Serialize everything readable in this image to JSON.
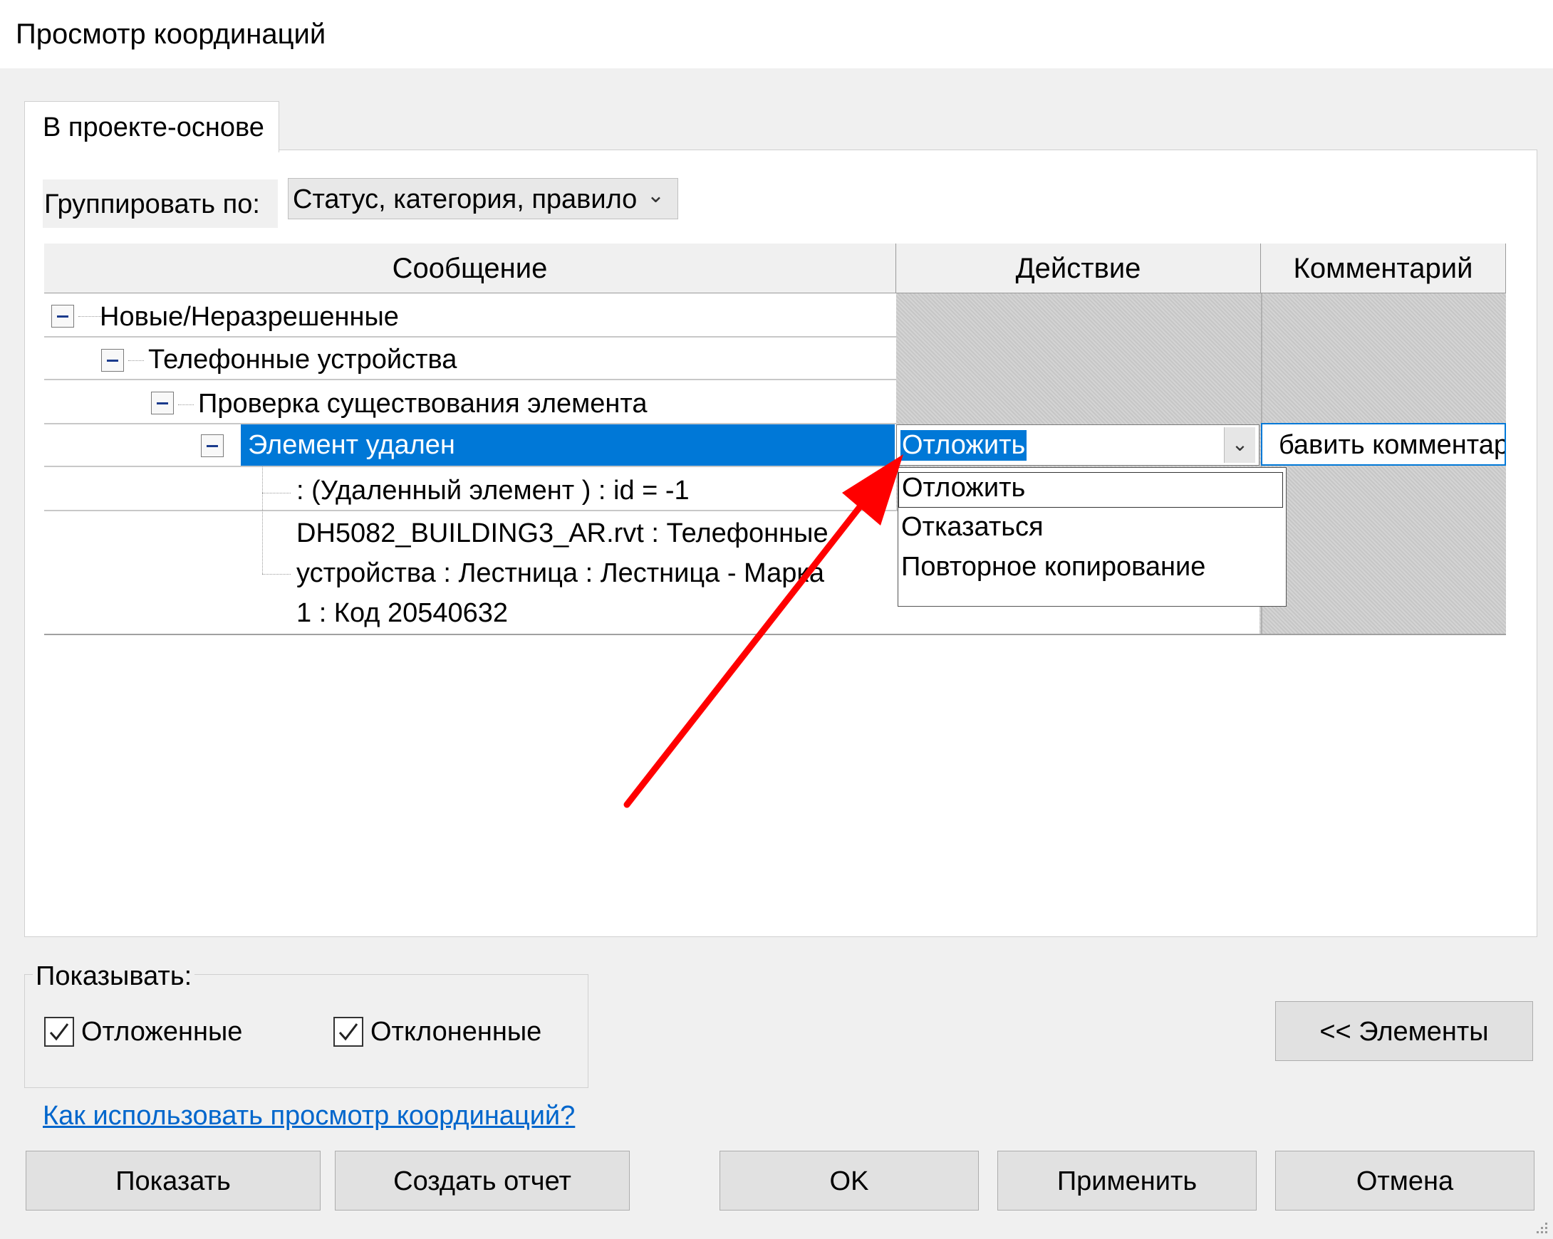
{
  "window": {
    "title": "Просмотр координаций"
  },
  "tabs": [
    {
      "label": "В проекте-основе"
    }
  ],
  "group_by": {
    "label": "Группировать по:",
    "value": "Статус, категория, правило"
  },
  "table": {
    "columns": [
      "Сообщение",
      "Действие",
      "Комментарий"
    ],
    "tree": {
      "level0": "Новые/Неразрешенные",
      "level1": "Телефонные устройства",
      "level2": "Проверка существования элемента",
      "level3": "Элемент удален",
      "detail1": ": (Удаленный элемент ) : id = -1",
      "detail2_line1": "DH5082_BUILDING3_AR.rvt : Телефонные",
      "detail2_line2": "устройства : Лестница : Лестница - Марка",
      "detail2_line3": "1 : Код 20540632"
    },
    "selected_action": "Отложить",
    "comment_placeholder": "бавить комментар"
  },
  "action_dropdown": {
    "options": [
      "Отложить",
      "Отказаться",
      "Повторное копирование"
    ]
  },
  "show": {
    "label": "Показывать:",
    "postponed": {
      "label": "Отложенные",
      "checked": true
    },
    "rejected": {
      "label": "Отклоненные",
      "checked": true
    }
  },
  "elements_button": "<< Элементы",
  "help_link": "Как использовать просмотр координаций?",
  "buttons": {
    "show": "Показать",
    "report": "Создать отчет",
    "ok": "OK",
    "apply": "Применить",
    "cancel": "Отмена"
  },
  "colors": {
    "selection": "#0078d7",
    "arrow": "#ff0000",
    "link": "#0066cc"
  }
}
